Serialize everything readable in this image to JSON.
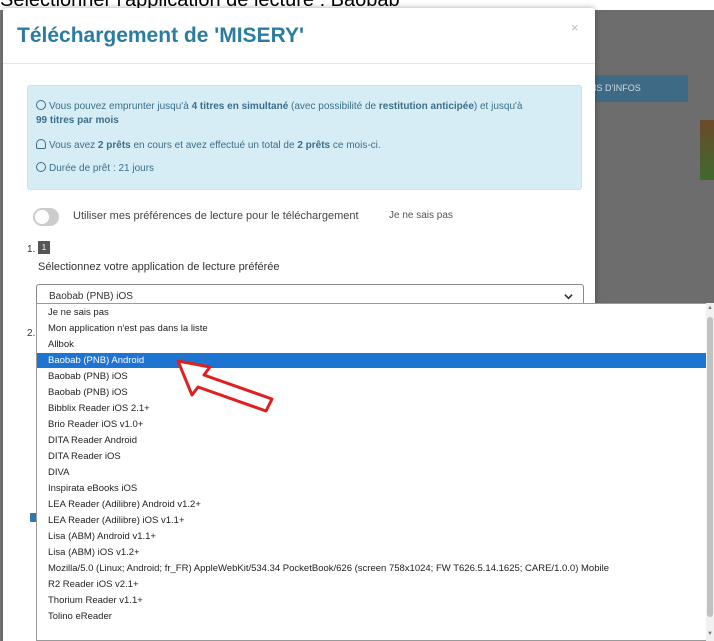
{
  "modal": {
    "title": "Téléchargement de 'MISERY'",
    "close_label": "×"
  },
  "background": {
    "caption_fragment": "Sélectionner l'application de lecture : Baobab",
    "banner_text": "IS D'INFOS"
  },
  "info": {
    "line1_a": "Vous pouvez emprunter jusqu'à ",
    "line1_b": "4 titres en simultané",
    "line1_c": " (avec possibilité de ",
    "line1_d": "restitution anticipée",
    "line1_e": ") et jusqu'à",
    "line2": "99 titres par mois",
    "line3_a": "Vous avez ",
    "line3_b": "2 prêts",
    "line3_c": " en cours et avez effectué un total de ",
    "line3_d": "2 prêts",
    "line3_e": " ce mois-ci.",
    "line4": "Durée de prêt : 21 jours"
  },
  "preferences": {
    "toggle_label": "Utiliser mes préférences de lecture pour le téléchargement",
    "aside": "Je ne sais pas"
  },
  "step1": {
    "number": "1.",
    "badge": "1",
    "label": "Sélectionnez votre application de lecture préférée",
    "selected_value": "Baobab (PNB) iOS"
  },
  "step2": {
    "number": "2."
  },
  "dropdown": {
    "selected_index": 3,
    "options": [
      "Je ne sais pas",
      "Mon application n'est pas dans la liste",
      "Allbok",
      "Baobab (PNB) Android",
      "Baobab (PNB) iOS",
      "Baobab (PNB) iOS",
      "Bibblix Reader iOS 2.1+",
      "Brio Reader iOS v1.0+",
      "DITA Reader Android",
      "DITA Reader iOS",
      "DIVA",
      "Inspirata eBooks iOS",
      "LEA Reader (Adilibre) Android v1.2+",
      "LEA Reader (Adilibre) iOS v1.1+",
      "Lisa (ABM) Android v1.1+",
      "Lisa (ABM) iOS v1.2+",
      "Mozilla/5.0 (Linux; Android; fr_FR) AppleWebKit/534.34 PocketBook/626 (screen 758x1024; FW T626.5.14.1625; CARE/1.0.0) Mobile",
      "R2 Reader iOS v2.1+",
      "Thorium Reader v1.1+",
      "Tolino eReader"
    ]
  },
  "colors": {
    "title": "#2c7ca2",
    "info_bg": "#d7edf5",
    "selection": "#1e74d1",
    "annotation_arrow": "#e02020"
  },
  "icons": {
    "info_line1": "info-circle-icon",
    "info_line3": "user-icon",
    "info_line4": "clock-icon",
    "select": "chevron-down-icon",
    "annotation": "red-arrow-icon"
  }
}
